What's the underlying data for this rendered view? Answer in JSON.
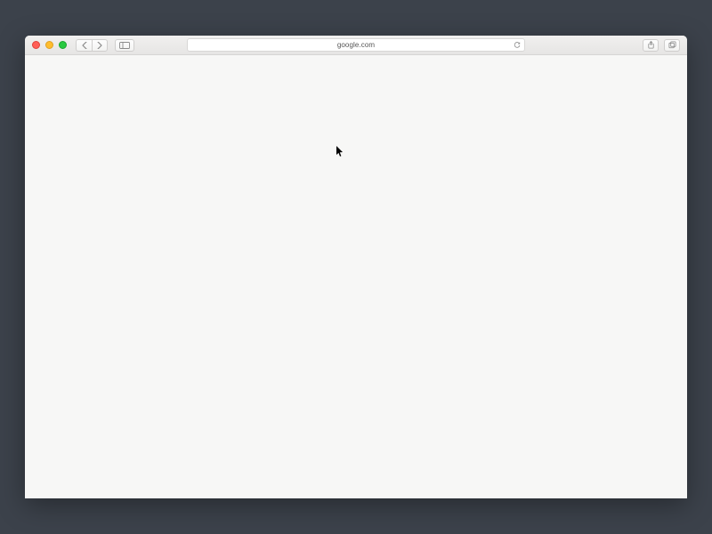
{
  "address_bar": {
    "url": "google.com"
  }
}
